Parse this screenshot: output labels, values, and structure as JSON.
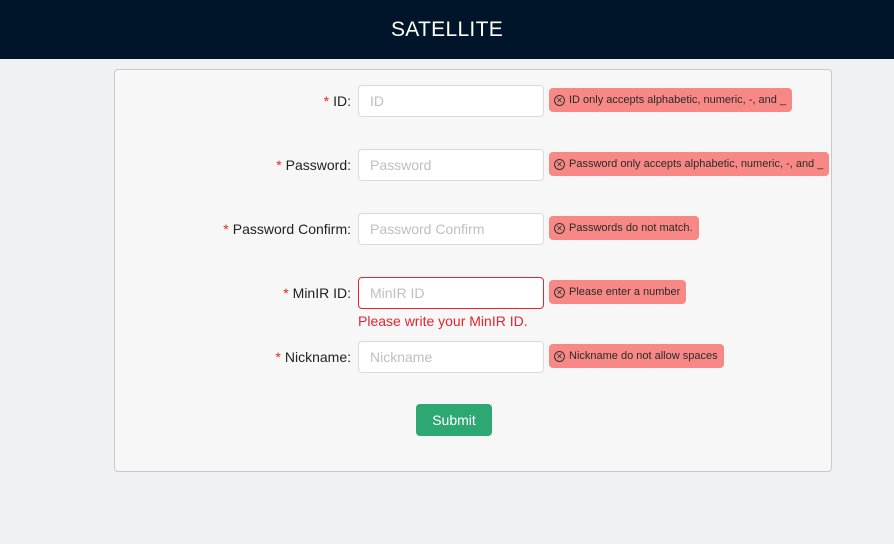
{
  "header": {
    "title": "SATELLITE"
  },
  "form": {
    "fields": [
      {
        "label": "ID",
        "required_mark": "*",
        "colon": ":",
        "placeholder": "ID",
        "value": "",
        "tooltip": "ID only accepts alphabetic, numeric, -, and _"
      },
      {
        "label": "Password",
        "required_mark": "*",
        "colon": ":",
        "placeholder": "Password",
        "value": "",
        "tooltip": "Password only accepts alphabetic, numeric, -, and _"
      },
      {
        "label": "Password Confirm",
        "required_mark": "*",
        "colon": ":",
        "placeholder": "Password Confirm",
        "value": "",
        "tooltip": "Passwords do not match."
      },
      {
        "label": "MinIR ID",
        "required_mark": "*",
        "colon": ":",
        "placeholder": "MinIR ID",
        "value": "",
        "tooltip": "Please enter a number",
        "error": "Please write your MinIR ID."
      },
      {
        "label": "Nickname",
        "required_mark": "*",
        "colon": ":",
        "placeholder": "Nickname",
        "value": "",
        "tooltip": "Nickname do not allow spaces"
      }
    ],
    "submit_label": "Submit"
  },
  "icons": {
    "tooltip_icon": "close-circle-icon"
  },
  "colors": {
    "header_bg": "#001529",
    "error": "#e0262f",
    "tooltip_bg": "#f88886",
    "submit_bg": "#2ea873"
  }
}
